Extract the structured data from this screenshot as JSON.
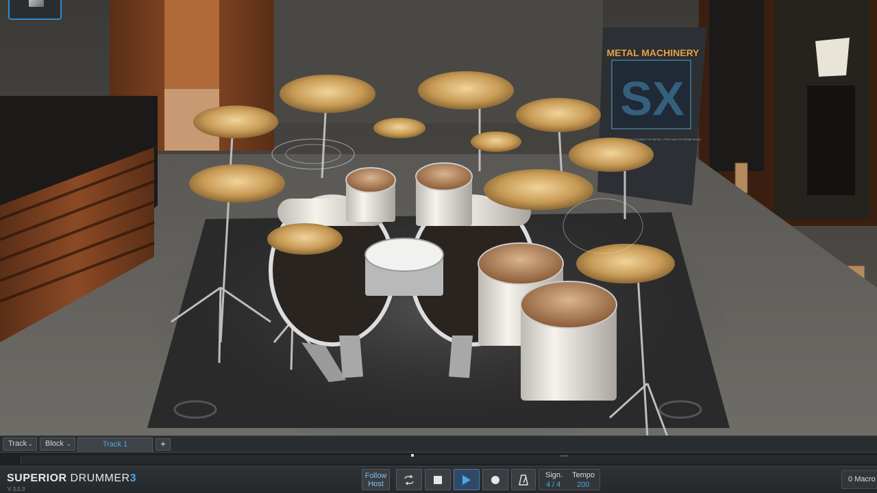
{
  "app": {
    "brand_superior": "SUPERIOR",
    "brand_drummer": "DRUMMER",
    "brand_number": "3",
    "version": "V 3.0.3"
  },
  "scene": {
    "banner_title": "METAL MACHINERY",
    "banner_tagline": "THE MOST AGGRESSIVE SOUNDS FOR METAL, PROG AND EXTREME MUSIC"
  },
  "track_bar": {
    "track_menu": "Track",
    "block_menu": "Block",
    "active_tab": "Track 1",
    "add_tab": "+"
  },
  "transport": {
    "follow_host_line1": "Follow",
    "follow_host_line2": "Host",
    "signature_label": "Sign.",
    "signature_value": "4 / 4",
    "tempo_label": "Tempo",
    "tempo_value": "200",
    "macro_count": "0",
    "macro_label": "Macro"
  },
  "colors": {
    "accent": "#4aa8e8",
    "selection_border": "#2c8bd0"
  },
  "icons": [
    "chevron-down-icon",
    "loop-icon",
    "stop-icon",
    "play-icon",
    "record-icon",
    "metronome-icon"
  ]
}
